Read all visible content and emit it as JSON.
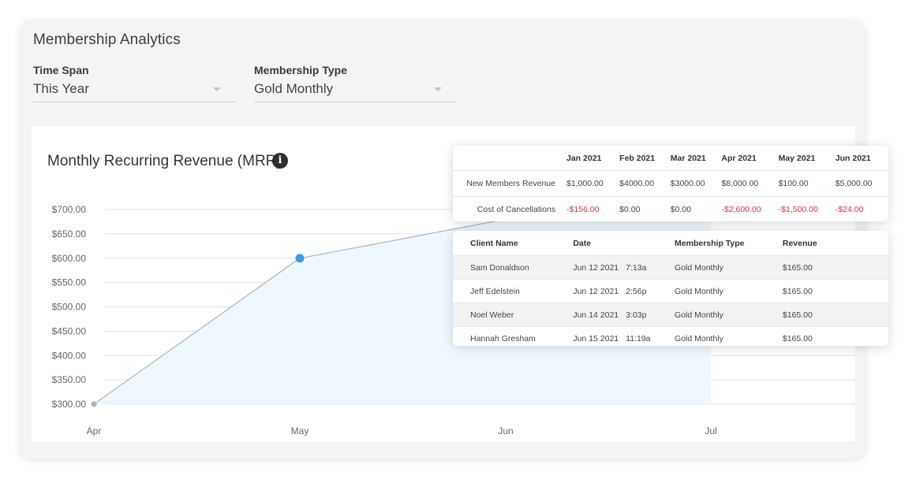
{
  "panel": {
    "title": "Membership Analytics"
  },
  "filters": {
    "time_span": {
      "label": "Time Span",
      "value": "This Year"
    },
    "membership_type": {
      "label": "Membership Type",
      "value": "Gold Monthly"
    }
  },
  "chart": {
    "title": "Monthly Recurring Revenue (MRR)",
    "info_icon": "i"
  },
  "chart_data": {
    "type": "area",
    "title": "Monthly Recurring Revenue (MRR)",
    "xlabel": "",
    "ylabel": "",
    "categories": [
      "Apr",
      "May",
      "Jun",
      "Jul"
    ],
    "series": [
      {
        "values": [
          300,
          600,
          680,
          700
        ]
      }
    ],
    "ylim": [
      300,
      700
    ],
    "yticks": [
      "$300.00",
      "$350.00",
      "$400.00",
      "$450.00",
      "$500.00",
      "$550.00",
      "$600.00",
      "$650.00",
      "$700.00"
    ],
    "highlighted_point": "May",
    "grid": true,
    "colors": {
      "line": "#a9b4c0",
      "fill": "#eef8fc",
      "point": "#3d9be3",
      "start_point": "#b0b0b6"
    }
  },
  "summary_table": {
    "columns": [
      "Jan 2021",
      "Feb 2021",
      "Mar 2021",
      "Apr 2021",
      "May 2021",
      "Jun 2021"
    ],
    "rows": [
      {
        "label": "New Members Revenue",
        "values": [
          "$1,000.00",
          "$4000.00",
          "$3000.00",
          "$8,000.00",
          "$100.00",
          "$5,000.00"
        ]
      },
      {
        "label": "Cost of Cancellations",
        "values": [
          "-$156.00",
          "$0.00",
          "$0.00",
          "-$2,600.00",
          "-$1,500.00",
          "-$24.00"
        ]
      }
    ]
  },
  "clients_table": {
    "columns": [
      "Client Name",
      "Date",
      "Membership Type",
      "Revenue"
    ],
    "rows": [
      {
        "name": "Sam Donaldson",
        "date": "Jun 12 2021",
        "time": "7:13a",
        "type": "Gold Monthly",
        "revenue": "$165.00"
      },
      {
        "name": "Jeff Edelstein",
        "date": "Jun 12 2021",
        "time": "2:56p",
        "type": "Gold Monthly",
        "revenue": "$165.00"
      },
      {
        "name": "Noel Weber",
        "date": "Jun 14 2021",
        "time": "3:03p",
        "type": "Gold Monthly",
        "revenue": "$165.00"
      },
      {
        "name": "Hannah Gresham",
        "date": "Jun 15 2021",
        "time": "11:19a",
        "type": "Gold Monthly",
        "revenue": "$165.00"
      }
    ]
  }
}
